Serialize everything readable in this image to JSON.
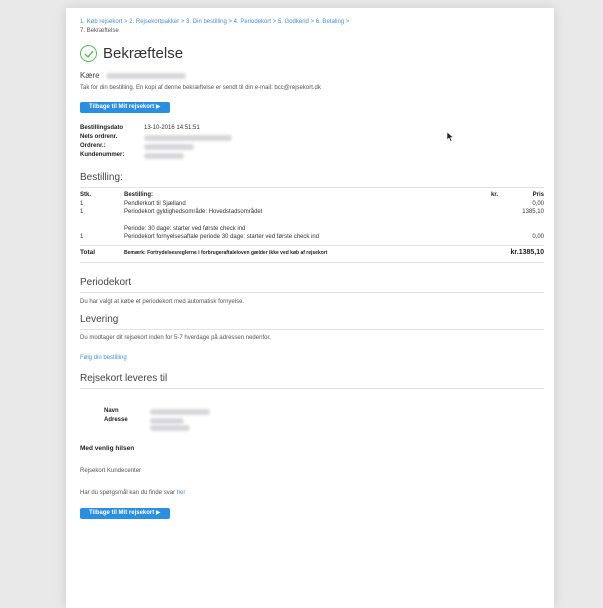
{
  "breadcrumb": {
    "steps": [
      "1. Køb rejsekort",
      "2. Rejsekortpakker",
      "3. Din bestilling",
      "4. Periodekort",
      "5. Godkend",
      "6. Betaling"
    ],
    "current": "7. Bekræftelse",
    "separator": ">"
  },
  "header": {
    "title": "Bekræftelse"
  },
  "greeting": {
    "salutation": "Kære",
    "message": "Tak for din bestilling. En kopi af denne bekræftelse er sendt til din e-mail: bcc@rejsekort.dk"
  },
  "buttons": {
    "back_to_my_card": "Tilbage til Mit rejsekort ▶"
  },
  "order_info": {
    "date_label": "Bestillingsdato",
    "date_value": "13-10-2016 14:51:51",
    "nets_label": "Nets ordrenr.",
    "order_label": "Ordrenr.:",
    "customer_label": "Kundenummer:"
  },
  "order": {
    "heading": "Bestilling:",
    "columns": {
      "qty": "Stk.",
      "item": "Bestilling:",
      "currency": "kr.",
      "price": "Pris"
    },
    "rows": [
      {
        "qty": "1",
        "item": "Pendlerkort til Sjælland",
        "price": "0,00"
      },
      {
        "qty": "1",
        "item": "Periodekort gyldighedsområde: Hovedstadsområdet",
        "price": "1385,10"
      },
      {
        "qty": "",
        "item": "Periode: 30 dage: starter ved første check ind",
        "price": ""
      },
      {
        "qty": "1",
        "item": "Periodekort fornyelsesaftale periode 30 dage: starter ved første check ind",
        "price": "0,00"
      }
    ],
    "total_label": "Total",
    "total_note": "Bemærk: Fortrydelsesreglerne i forbrugeraftaleloven gælder ikke ved køb af rejsekort",
    "total_value": "kr.1385,10"
  },
  "periodekort": {
    "heading": "Periodekort",
    "text": "Du har valgt at købe et periodekort med automatisk fornyelse."
  },
  "levering": {
    "heading": "Levering",
    "text": "Du modtager dit rejsekort inden for 5-7 hverdage på adressen nedenfor.",
    "follow_link": "Følg din bestilling"
  },
  "delivery": {
    "heading": "Rejsekort leveres til",
    "name_label": "Navn",
    "address_label": "Adresse"
  },
  "closing": {
    "regards": "Med venlig hilsen",
    "signature": "Rejsekort Kundecenter",
    "question": "Har du spørgsmål kan du finde svar",
    "question_link": "her"
  }
}
